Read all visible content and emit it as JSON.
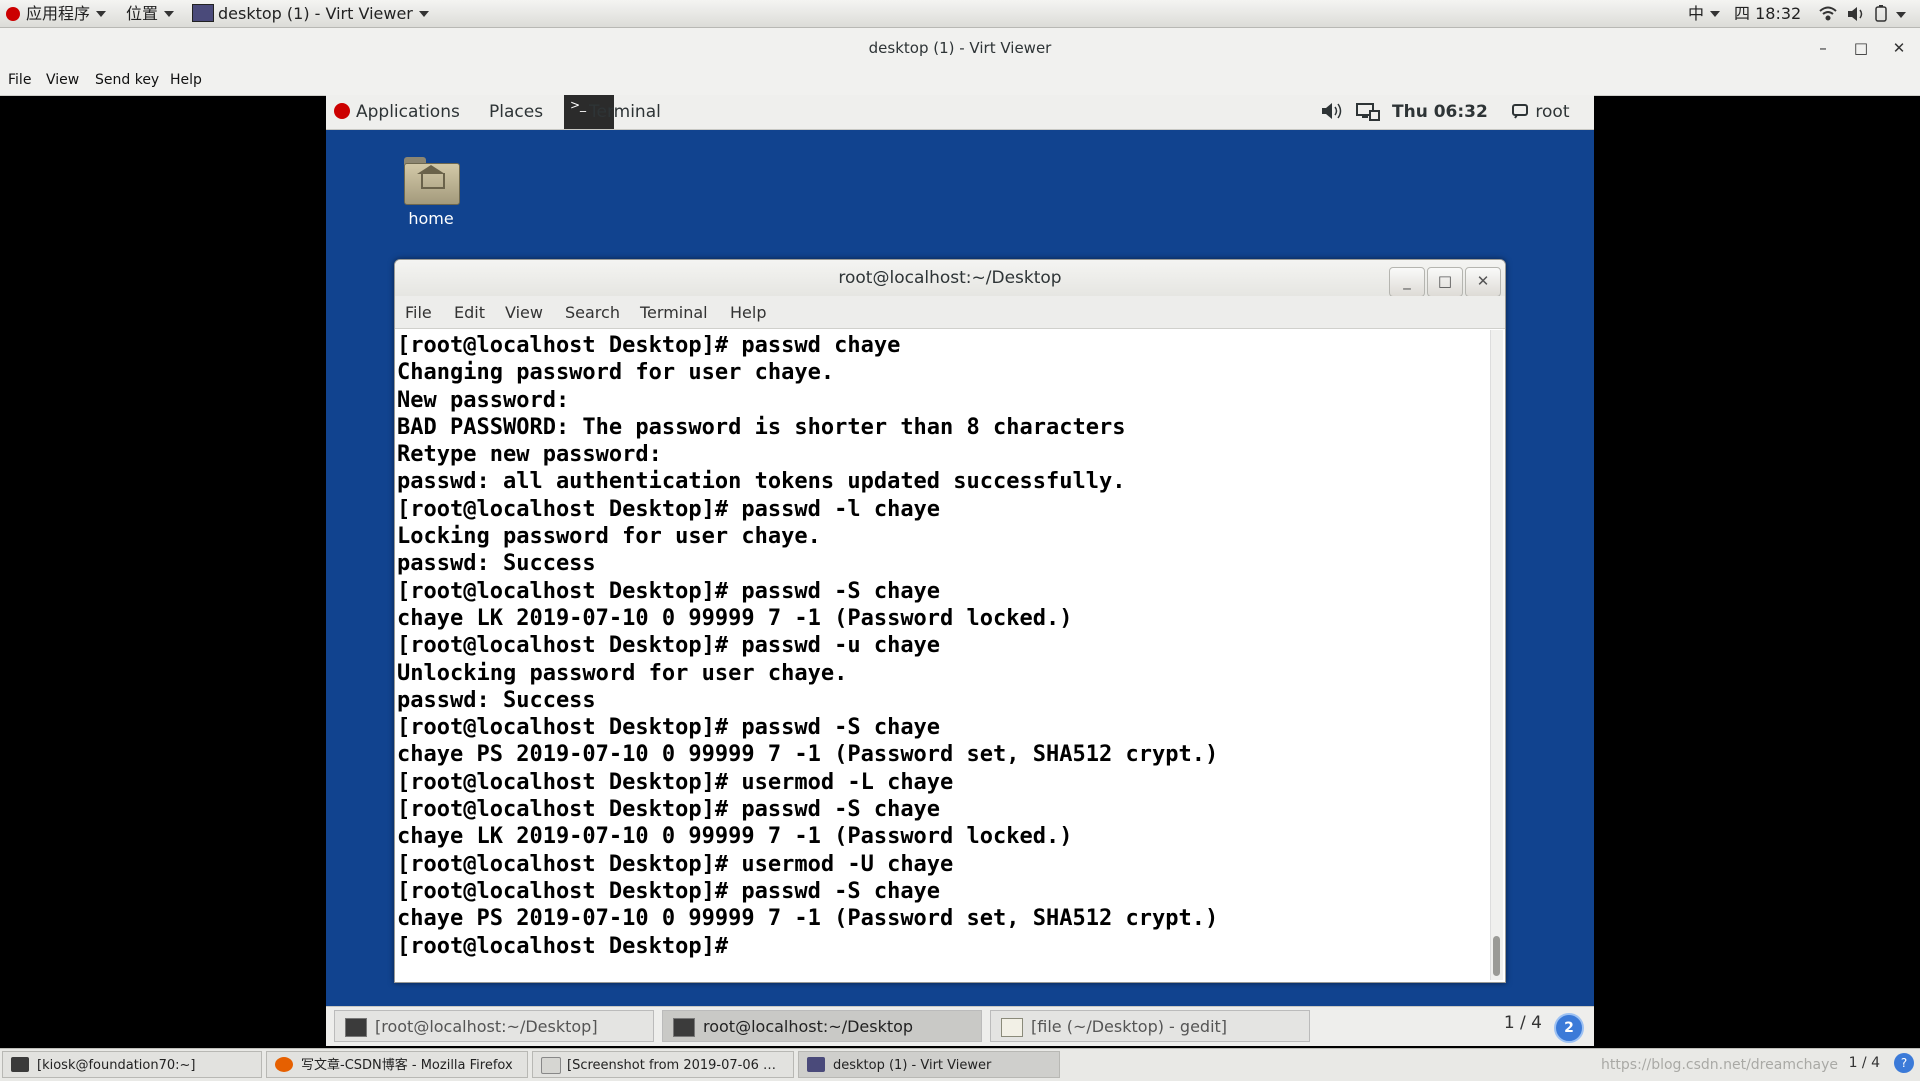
{
  "host_panel": {
    "apps_menu": "应用程序",
    "places_menu": "位置",
    "active_window": "desktop (1) - Virt Viewer",
    "input_method": "中",
    "clock": "四 18:32"
  },
  "viewer": {
    "title": "desktop (1) - Virt Viewer",
    "menu": [
      "File",
      "View",
      "Send key",
      "Help"
    ]
  },
  "guest": {
    "panel": {
      "applications": "Applications",
      "places": "Places",
      "active_app": "Terminal",
      "clock": "Thu 06:32",
      "user": "root"
    },
    "desktop_icon_label": "home",
    "terminal": {
      "title": "root@localhost:~/Desktop",
      "menu": [
        "File",
        "Edit",
        "View",
        "Search",
        "Terminal",
        "Help"
      ],
      "output": "[root@localhost Desktop]# passwd chaye\nChanging password for user chaye.\nNew password: \nBAD PASSWORD: The password is shorter than 8 characters\nRetype new password: \npasswd: all authentication tokens updated successfully.\n[root@localhost Desktop]# passwd -l chaye\nLocking password for user chaye.\npasswd: Success\n[root@localhost Desktop]# passwd -S chaye\nchaye LK 2019-07-10 0 99999 7 -1 (Password locked.)\n[root@localhost Desktop]# passwd -u chaye\nUnlocking password for user chaye.\npasswd: Success\n[root@localhost Desktop]# passwd -S chaye\nchaye PS 2019-07-10 0 99999 7 -1 (Password set, SHA512 crypt.)\n[root@localhost Desktop]# usermod -L chaye\n[root@localhost Desktop]# passwd -S chaye\nchaye LK 2019-07-10 0 99999 7 -1 (Password locked.)\n[root@localhost Desktop]# usermod -U chaye\n[root@localhost Desktop]# passwd -S chaye\nchaye PS 2019-07-10 0 99999 7 -1 (Password set, SHA512 crypt.)\n[root@localhost Desktop]# "
    },
    "tasks": [
      {
        "label": "[root@localhost:~/Desktop]",
        "icon": "terminal-icon"
      },
      {
        "label": "root@localhost:~/Desktop",
        "icon": "terminal-icon"
      },
      {
        "label": "[file (~/Desktop) - gedit]",
        "icon": "gedit-icon"
      }
    ],
    "workspace": "1 / 4",
    "help_badge": "2"
  },
  "host_tasks": [
    {
      "label": "[kiosk@foundation70:~]",
      "icon": "terminal-icon"
    },
    {
      "label": "写文章-CSDN博客 - Mozilla Firefox",
      "icon": "firefox-icon"
    },
    {
      "label": "[Screenshot from 2019-07-06 …",
      "icon": "screenshot-icon"
    },
    {
      "label": "desktop (1) - Virt Viewer",
      "icon": "virt-viewer-icon"
    }
  ],
  "host_workspace": "1 / 4",
  "watermark": "https://blog.csdn.net/dreamchaye",
  "colors": {
    "guest_desktop": "#11438f",
    "redhat": "#cc0000",
    "badge": "#3b7ad8"
  }
}
